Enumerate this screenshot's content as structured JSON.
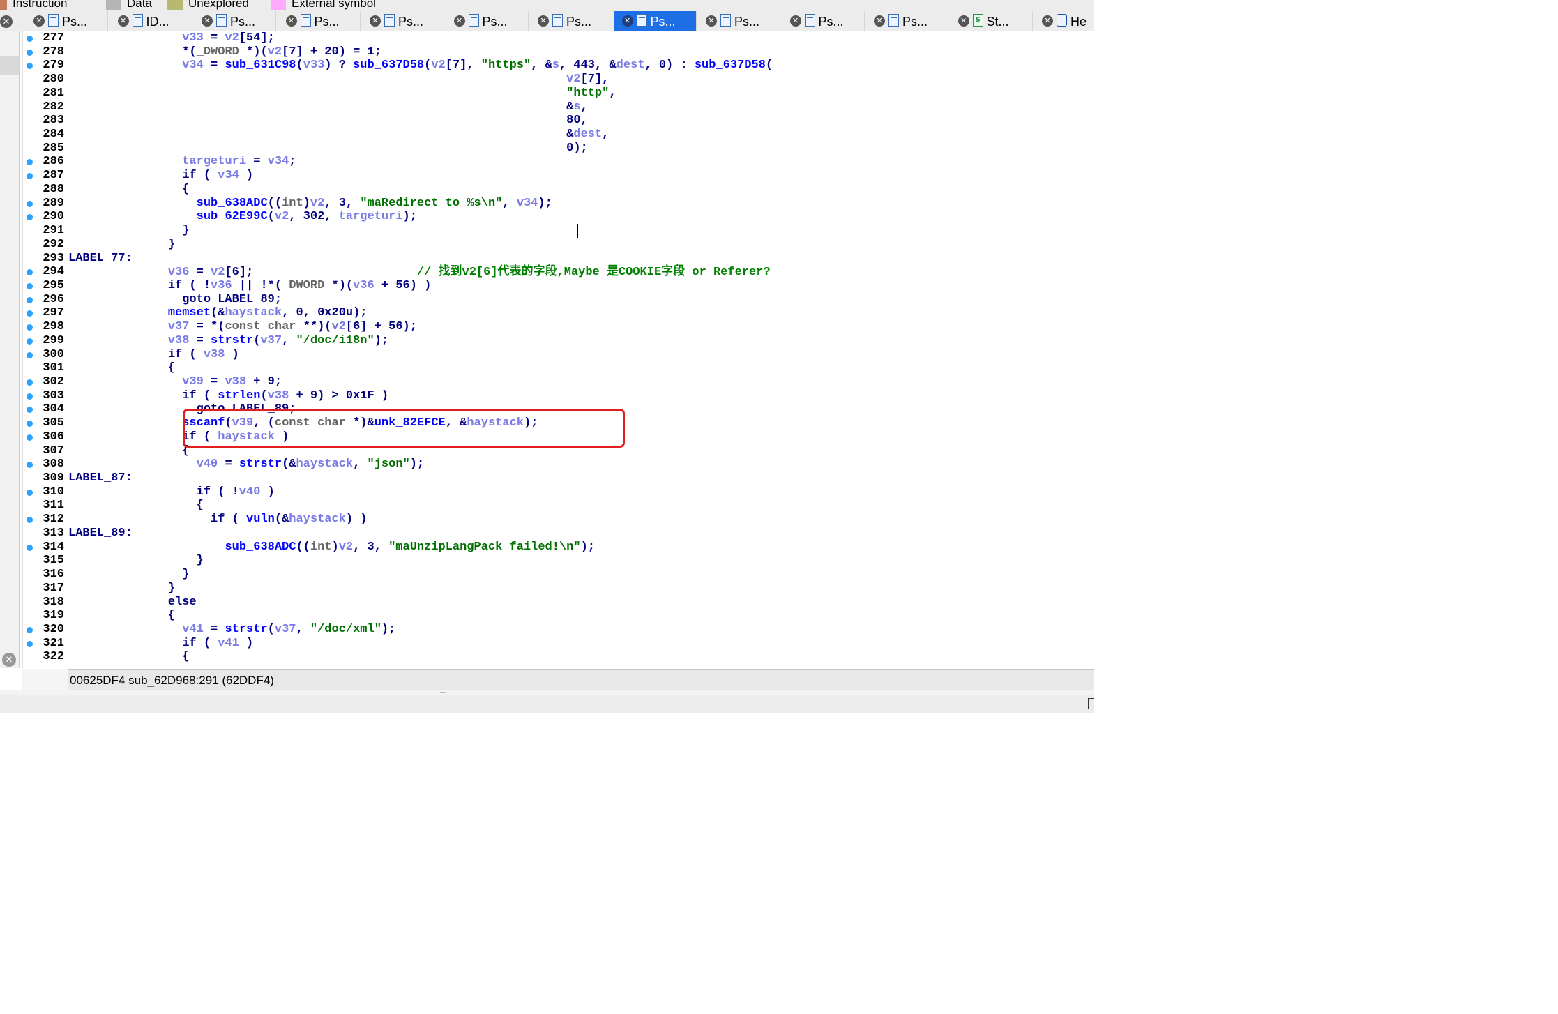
{
  "legend": [
    {
      "label": "Instruction",
      "color": "#c87b5a"
    },
    {
      "label": "Data",
      "color": "#b5b5b5"
    },
    {
      "label": "Unexplored",
      "color": "#b8b871"
    },
    {
      "label": "External symbol",
      "color": "#ffaaff"
    }
  ],
  "tabs": [
    {
      "label": "Ps...",
      "kind": "pseudocode",
      "active": false
    },
    {
      "label": "ID...",
      "kind": "pseudocode",
      "active": false
    },
    {
      "label": "Ps...",
      "kind": "pseudocode",
      "active": false
    },
    {
      "label": "Ps...",
      "kind": "pseudocode",
      "active": false
    },
    {
      "label": "Ps...",
      "kind": "pseudocode",
      "active": false
    },
    {
      "label": "Ps...",
      "kind": "pseudocode",
      "active": false
    },
    {
      "label": "Ps...",
      "kind": "pseudocode",
      "active": false
    },
    {
      "label": "Ps...",
      "kind": "pseudocode",
      "active": true
    },
    {
      "label": "Ps...",
      "kind": "pseudocode",
      "active": false
    },
    {
      "label": "Ps...",
      "kind": "pseudocode",
      "active": false
    },
    {
      "label": "Ps...",
      "kind": "pseudocode",
      "active": false
    },
    {
      "label": "St...",
      "kind": "str",
      "active": false
    },
    {
      "label": "He",
      "kind": "hex",
      "active": false
    }
  ],
  "code_lines": [
    {
      "n": "277",
      "bp": true,
      "t": [
        [
          "                ",
          ""
        ],
        [
          "v33",
          "var"
        ],
        [
          " = ",
          "d"
        ],
        [
          "v2",
          "var"
        ],
        [
          "[54];",
          "d"
        ]
      ]
    },
    {
      "n": "278",
      "bp": true,
      "t": [
        [
          "                *(",
          "d"
        ],
        [
          "_DWORD",
          "type"
        ],
        [
          " *)(",
          "d"
        ],
        [
          "v2",
          "var"
        ],
        [
          "[7] + 20) = 1;",
          "d"
        ]
      ]
    },
    {
      "n": "279",
      "bp": true,
      "t": [
        [
          "                ",
          ""
        ],
        [
          "v34",
          "var"
        ],
        [
          " = ",
          "d"
        ],
        [
          "sub_631C98",
          "func"
        ],
        [
          "(",
          "d"
        ],
        [
          "v33",
          "var"
        ],
        [
          ") ? ",
          "d"
        ],
        [
          "sub_637D58",
          "func"
        ],
        [
          "(",
          "d"
        ],
        [
          "v2",
          "var"
        ],
        [
          "[7], ",
          "d"
        ],
        [
          "\"https\"",
          "str"
        ],
        [
          ", &",
          "d"
        ],
        [
          "s",
          "var"
        ],
        [
          ", 443, &",
          "d"
        ],
        [
          "dest",
          "var"
        ],
        [
          ", 0) : ",
          "d"
        ],
        [
          "sub_637D58",
          "func"
        ],
        [
          "(",
          "d"
        ]
      ]
    },
    {
      "n": "280",
      "bp": false,
      "t": [
        [
          "                                                                      ",
          ""
        ],
        [
          "v2",
          "var"
        ],
        [
          "[7],",
          "d"
        ]
      ]
    },
    {
      "n": "281",
      "bp": false,
      "t": [
        [
          "                                                                      ",
          ""
        ],
        [
          "\"http\"",
          "str"
        ],
        [
          ",",
          "d"
        ]
      ]
    },
    {
      "n": "282",
      "bp": false,
      "t": [
        [
          "                                                                      &",
          ""
        ],
        [
          "s",
          "var"
        ],
        [
          ",",
          "d"
        ]
      ]
    },
    {
      "n": "283",
      "bp": false,
      "t": [
        [
          "                                                                      80,",
          "d"
        ]
      ]
    },
    {
      "n": "284",
      "bp": false,
      "t": [
        [
          "                                                                      &",
          "d"
        ],
        [
          "dest",
          "var"
        ],
        [
          ",",
          "d"
        ]
      ]
    },
    {
      "n": "285",
      "bp": false,
      "t": [
        [
          "                                                                      0);",
          "d"
        ]
      ]
    },
    {
      "n": "286",
      "bp": true,
      "t": [
        [
          "                ",
          ""
        ],
        [
          "targeturi",
          "var"
        ],
        [
          " = ",
          "d"
        ],
        [
          "v34",
          "var"
        ],
        [
          ";",
          "d"
        ]
      ]
    },
    {
      "n": "287",
      "bp": true,
      "t": [
        [
          "                if ( ",
          "d"
        ],
        [
          "v34",
          "var"
        ],
        [
          " )",
          "d"
        ]
      ]
    },
    {
      "n": "288",
      "bp": false,
      "t": [
        [
          "                {",
          "d"
        ]
      ]
    },
    {
      "n": "289",
      "bp": true,
      "t": [
        [
          "                  ",
          ""
        ],
        [
          "sub_638ADC",
          "func"
        ],
        [
          "((",
          "d"
        ],
        [
          "int",
          "type"
        ],
        [
          ")",
          "d"
        ],
        [
          "v2",
          "var"
        ],
        [
          ", 3, ",
          "d"
        ],
        [
          "\"maRedirect to %s\\n\"",
          "str"
        ],
        [
          ", ",
          "d"
        ],
        [
          "v34",
          "var"
        ],
        [
          ");",
          "d"
        ]
      ]
    },
    {
      "n": "290",
      "bp": true,
      "t": [
        [
          "                  ",
          ""
        ],
        [
          "sub_62E99C",
          "func"
        ],
        [
          "(",
          "d"
        ],
        [
          "v2",
          "var"
        ],
        [
          ", 302, ",
          "d"
        ],
        [
          "targeturi",
          "var"
        ],
        [
          ");",
          "d"
        ]
      ]
    },
    {
      "n": "291",
      "bp": false,
      "t": [
        [
          "                }",
          "d"
        ]
      ]
    },
    {
      "n": "292",
      "bp": false,
      "t": [
        [
          "              }",
          "d"
        ]
      ]
    },
    {
      "n": "293",
      "bp": false,
      "t": [
        [
          "LABEL_77:",
          "d"
        ]
      ]
    },
    {
      "n": "294",
      "bp": true,
      "t": [
        [
          "              ",
          ""
        ],
        [
          "v36",
          "var"
        ],
        [
          " = ",
          "d"
        ],
        [
          "v2",
          "var"
        ],
        [
          "[6];                       ",
          "d"
        ],
        [
          "// ",
          "comment"
        ],
        [
          "找到",
          "cjk"
        ],
        [
          "v2[6]",
          "comment"
        ],
        [
          "代表的字段",
          "cjk"
        ],
        [
          ",Maybe ",
          "comment"
        ],
        [
          "是",
          "cjk"
        ],
        [
          "COOKIE",
          "comment"
        ],
        [
          "字段",
          "cjk"
        ],
        [
          " or Referer?",
          "comment"
        ]
      ]
    },
    {
      "n": "295",
      "bp": true,
      "t": [
        [
          "              if ( !",
          "d"
        ],
        [
          "v36",
          "var"
        ],
        [
          " || !*(",
          "d"
        ],
        [
          "_DWORD",
          "type"
        ],
        [
          " *)(",
          "d"
        ],
        [
          "v36",
          "var"
        ],
        [
          " + 56) )",
          "d"
        ]
      ]
    },
    {
      "n": "296",
      "bp": true,
      "t": [
        [
          "                goto LABEL_89;",
          "d"
        ]
      ]
    },
    {
      "n": "297",
      "bp": true,
      "t": [
        [
          "              ",
          ""
        ],
        [
          "memset",
          "func"
        ],
        [
          "(&",
          "d"
        ],
        [
          "haystack",
          "var"
        ],
        [
          ", 0, 0x20u);",
          "d"
        ]
      ]
    },
    {
      "n": "298",
      "bp": true,
      "t": [
        [
          "              ",
          ""
        ],
        [
          "v37",
          "var"
        ],
        [
          " = *(",
          "d"
        ],
        [
          "const char",
          "type"
        ],
        [
          " **)(",
          "d"
        ],
        [
          "v2",
          "var"
        ],
        [
          "[6] + 56);",
          "d"
        ]
      ]
    },
    {
      "n": "299",
      "bp": true,
      "t": [
        [
          "              ",
          ""
        ],
        [
          "v38",
          "var"
        ],
        [
          " = ",
          "d"
        ],
        [
          "strstr",
          "func"
        ],
        [
          "(",
          "d"
        ],
        [
          "v37",
          "var"
        ],
        [
          ", ",
          "d"
        ],
        [
          "\"/doc/i18n\"",
          "str"
        ],
        [
          ");",
          "d"
        ]
      ]
    },
    {
      "n": "300",
      "bp": true,
      "t": [
        [
          "              if ( ",
          "d"
        ],
        [
          "v38",
          "var"
        ],
        [
          " )",
          "d"
        ]
      ]
    },
    {
      "n": "301",
      "bp": false,
      "t": [
        [
          "              {",
          "d"
        ]
      ]
    },
    {
      "n": "302",
      "bp": true,
      "t": [
        [
          "                ",
          ""
        ],
        [
          "v39",
          "var"
        ],
        [
          " = ",
          "d"
        ],
        [
          "v38",
          "var"
        ],
        [
          " + 9;",
          "d"
        ]
      ]
    },
    {
      "n": "303",
      "bp": true,
      "t": [
        [
          "                if ( ",
          "d"
        ],
        [
          "strlen",
          "func"
        ],
        [
          "(",
          "d"
        ],
        [
          "v38",
          "var"
        ],
        [
          " + 9) > 0x1F )",
          "d"
        ]
      ]
    },
    {
      "n": "304",
      "bp": true,
      "t": [
        [
          "                  goto LABEL_89;",
          "d"
        ]
      ]
    },
    {
      "n": "305",
      "bp": true,
      "t": [
        [
          "                ",
          ""
        ],
        [
          "sscanf",
          "func"
        ],
        [
          "(",
          "d"
        ],
        [
          "v39",
          "var"
        ],
        [
          ", (",
          "d"
        ],
        [
          "const char",
          "type"
        ],
        [
          " *)&",
          "d"
        ],
        [
          "unk_82EFCE",
          "func"
        ],
        [
          ", &",
          "d"
        ],
        [
          "haystack",
          "var"
        ],
        [
          ");",
          "d"
        ]
      ]
    },
    {
      "n": "306",
      "bp": true,
      "t": [
        [
          "                if ( ",
          "d"
        ],
        [
          "haystack",
          "var"
        ],
        [
          " )",
          "d"
        ]
      ]
    },
    {
      "n": "307",
      "bp": false,
      "t": [
        [
          "                {",
          "d"
        ]
      ]
    },
    {
      "n": "308",
      "bp": true,
      "t": [
        [
          "                  ",
          ""
        ],
        [
          "v40",
          "var"
        ],
        [
          " = ",
          "d"
        ],
        [
          "strstr",
          "func"
        ],
        [
          "(&",
          "d"
        ],
        [
          "haystack",
          "var"
        ],
        [
          ", ",
          "d"
        ],
        [
          "\"json\"",
          "str"
        ],
        [
          ");",
          "d"
        ]
      ]
    },
    {
      "n": "309",
      "bp": false,
      "t": [
        [
          "LABEL_87:",
          "d"
        ]
      ]
    },
    {
      "n": "310",
      "bp": true,
      "t": [
        [
          "                  if ( !",
          "d"
        ],
        [
          "v40",
          "var"
        ],
        [
          " )",
          "d"
        ]
      ]
    },
    {
      "n": "311",
      "bp": false,
      "t": [
        [
          "                  {",
          "d"
        ]
      ]
    },
    {
      "n": "312",
      "bp": true,
      "t": [
        [
          "                    if ( ",
          "d"
        ],
        [
          "vuln",
          "func"
        ],
        [
          "(&",
          "d"
        ],
        [
          "haystack",
          "var"
        ],
        [
          ") )",
          "d"
        ]
      ]
    },
    {
      "n": "313",
      "bp": false,
      "t": [
        [
          "LABEL_89:",
          "d"
        ]
      ]
    },
    {
      "n": "314",
      "bp": true,
      "t": [
        [
          "                      ",
          ""
        ],
        [
          "sub_638ADC",
          "func"
        ],
        [
          "((",
          "d"
        ],
        [
          "int",
          "type"
        ],
        [
          ")",
          "d"
        ],
        [
          "v2",
          "var"
        ],
        [
          ", 3, ",
          "d"
        ],
        [
          "\"maUnzipLangPack failed!\\n\"",
          "str"
        ],
        [
          ");",
          "d"
        ]
      ]
    },
    {
      "n": "315",
      "bp": false,
      "t": [
        [
          "                  }",
          "d"
        ]
      ]
    },
    {
      "n": "316",
      "bp": false,
      "t": [
        [
          "                }",
          "d"
        ]
      ]
    },
    {
      "n": "317",
      "bp": false,
      "t": [
        [
          "              }",
          "d"
        ]
      ]
    },
    {
      "n": "318",
      "bp": false,
      "t": [
        [
          "              else",
          "d"
        ]
      ]
    },
    {
      "n": "319",
      "bp": false,
      "t": [
        [
          "              {",
          "d"
        ]
      ]
    },
    {
      "n": "320",
      "bp": true,
      "t": [
        [
          "                ",
          ""
        ],
        [
          "v41",
          "var"
        ],
        [
          " = ",
          "d"
        ],
        [
          "strstr",
          "func"
        ],
        [
          "(",
          "d"
        ],
        [
          "v37",
          "var"
        ],
        [
          ", ",
          "d"
        ],
        [
          "\"/doc/xml\"",
          "str"
        ],
        [
          ");",
          "d"
        ]
      ]
    },
    {
      "n": "321",
      "bp": true,
      "t": [
        [
          "                if ( ",
          "d"
        ],
        [
          "v41",
          "var"
        ],
        [
          " )",
          "d"
        ]
      ]
    },
    {
      "n": "322",
      "bp": false,
      "t": [
        [
          "                {",
          "d"
        ]
      ]
    }
  ],
  "status_text": "00625DF4 sub_62D968:291 (62DDF4)",
  "colors": {
    "keyword": "#000080",
    "variable": "#7a7ae6",
    "function": "#0000ff",
    "string": "#007000",
    "comment": "#008000",
    "type": "#666666",
    "breakpoint_dot": "#29a3ff",
    "active_tab": "#1e6ee6",
    "highlight_box": "#e21f1f"
  }
}
